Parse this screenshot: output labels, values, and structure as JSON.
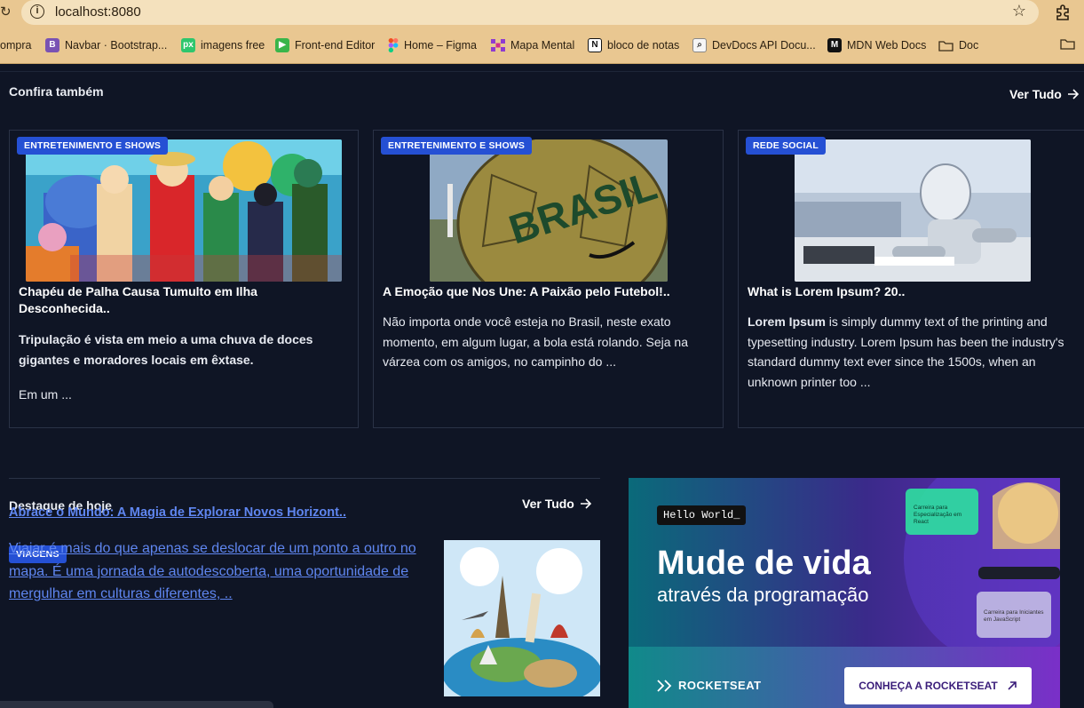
{
  "browser": {
    "url": "localhost:8080",
    "bookmarks": [
      {
        "label": "ompra",
        "icon": "none"
      },
      {
        "label": "Navbar · Bootstrap...",
        "icon": "bootstrap-icon",
        "color": "#7952b3"
      },
      {
        "label": "imagens free",
        "icon": "pixabay-icon",
        "color": "#2ec66d"
      },
      {
        "label": "Front-end Editor",
        "icon": "editor-icon",
        "color": "#39b54a"
      },
      {
        "label": "Home – Figma",
        "icon": "figma-icon",
        "color": "#f24e1e"
      },
      {
        "label": "Mapa Mental",
        "icon": "mindmap-icon",
        "color": "#8e3bd0"
      },
      {
        "label": "bloco de notas",
        "icon": "notion-icon",
        "color": "#111111"
      },
      {
        "label": "DevDocs API Docu...",
        "icon": "devdocs-icon",
        "color": "#6b6b6b"
      },
      {
        "label": "MDN Web Docs",
        "icon": "mdn-icon",
        "color": "#111111"
      },
      {
        "label": "Doc",
        "icon": "folder-icon",
        "color": "#3a2d18"
      }
    ]
  },
  "confira": {
    "title": "Confira também",
    "see_all": "Ver Tudo",
    "cards": [
      {
        "badge": "ENTRETENIMENTO E SHOWS",
        "title": "Chapéu de Palha Causa Tumulto em Ilha Desconhecida..",
        "text_lead": "Tripulação é vista em meio a uma chuva de doces gigantes e moradores locais em êxtase.",
        "text_tail": "Em um ..."
      },
      {
        "badge": "ENTRETENIMENTO E SHOWS",
        "title": "A Emoção que Nos Une: A Paixão pelo Futebol!..",
        "text": "Não importa onde você esteja no Brasil, neste exato momento, em algum lugar, a bola está rolando. Seja na várzea com os amigos, no campinho do ..."
      },
      {
        "badge": "REDE SOCIAL",
        "title": "What is Lorem Ipsum? 20..",
        "text_bold": "Lorem Ipsum",
        "text": " is simply dummy text of the printing and typesetting industry. Lorem Ipsum has been the industry's standard dummy text ever since the 1500s, when an unknown printer too ..."
      }
    ]
  },
  "destaque": {
    "title": "Destaque de hoje",
    "see_all": "Ver Tudo",
    "badge": "VIAGENS",
    "headline": "Abrace o Mundo: A Magia de Explorar Novos Horizont..",
    "text": "Viajar é mais do que apenas se deslocar de um ponto a outro no mapa. É uma jornada de autodescoberta, uma oportunidade de mergulhar em culturas diferentes, .."
  },
  "ad": {
    "terminal": "Hello World_",
    "headline": "Mude de vida",
    "subheadline": "através da programação",
    "brand": "ROCKETSEAT",
    "cta": "CONHEÇA A ROCKETSEAT",
    "card1": "Carreira para Especialização em React",
    "card2": "Carreira para Iniciantes em JavaScript"
  }
}
